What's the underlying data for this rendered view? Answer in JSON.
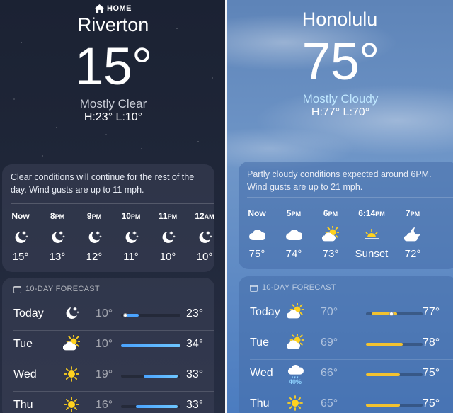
{
  "left": {
    "home_label": "HOME",
    "city": "Riverton",
    "temperature": "15°",
    "condition": "Mostly Clear",
    "high_low": "H:23°  L:10°",
    "summary": "Clear conditions will continue for the rest of the day. Wind gusts are up to 11 mph.",
    "hourly": [
      {
        "time": "Now",
        "suffix": "",
        "icon": "moon-stars-icon",
        "temp": "15°"
      },
      {
        "time": "8",
        "suffix": "PM",
        "icon": "moon-stars-icon",
        "temp": "13°"
      },
      {
        "time": "9",
        "suffix": "PM",
        "icon": "moon-stars-icon",
        "temp": "12°"
      },
      {
        "time": "10",
        "suffix": "PM",
        "icon": "moon-stars-icon",
        "temp": "11°"
      },
      {
        "time": "11",
        "suffix": "PM",
        "icon": "moon-stars-icon",
        "temp": "10°"
      },
      {
        "time": "12",
        "suffix": "AM",
        "icon": "moon-stars-icon",
        "temp": "10°"
      }
    ],
    "forecast_title": "10-DAY FORECAST",
    "daily": [
      {
        "day": "Today",
        "icon": "moon-stars-icon",
        "low": "10°",
        "high": "23°",
        "range": [
          0.05,
          0.3
        ],
        "current": 0.07
      },
      {
        "day": "Tue",
        "icon": "partly-cloudy-sun-icon",
        "low": "10°",
        "high": "34°",
        "range": [
          0.0,
          1.0
        ]
      },
      {
        "day": "Wed",
        "icon": "sun-icon",
        "low": "19°",
        "high": "33°",
        "range": [
          0.38,
          0.95
        ]
      },
      {
        "day": "Thu",
        "icon": "sun-icon",
        "low": "16°",
        "high": "33°",
        "range": [
          0.25,
          0.95
        ]
      }
    ]
  },
  "right": {
    "city": "Honolulu",
    "temperature": "75°",
    "condition": "Mostly Cloudy",
    "high_low": "H:77°  L:70°",
    "summary": "Partly cloudy conditions expected around 6PM. Wind gusts are up to 21 mph.",
    "hourly": [
      {
        "time": "Now",
        "suffix": "",
        "icon": "cloud-icon",
        "temp": "75°"
      },
      {
        "time": "5",
        "suffix": "PM",
        "icon": "cloud-icon",
        "temp": "74°"
      },
      {
        "time": "6",
        "suffix": "PM",
        "icon": "partly-cloudy-sun-icon",
        "temp": "73°"
      },
      {
        "time": "6:14",
        "suffix": "PM",
        "icon": "sunset-icon",
        "temp": "Sunset"
      },
      {
        "time": "7",
        "suffix": "PM",
        "icon": "partly-cloudy-moon-icon",
        "temp": "72°"
      }
    ],
    "forecast_title": "10-DAY FORECAST",
    "daily": [
      {
        "day": "Today",
        "icon": "partly-cloudy-sun-icon",
        "low": "70°",
        "high": "77°",
        "range": [
          0.1,
          0.55
        ],
        "current": 0.45
      },
      {
        "day": "Tue",
        "icon": "partly-cloudy-sun-icon",
        "low": "69°",
        "high": "78°",
        "range": [
          0.0,
          0.65
        ]
      },
      {
        "day": "Wed",
        "icon": "rain-cloud-icon",
        "low": "66°",
        "high": "75°",
        "precip": "40%",
        "range": [
          0.0,
          0.6
        ]
      },
      {
        "day": "Thu",
        "icon": "sun-icon",
        "low": "65°",
        "high": "75°",
        "range": [
          0.0,
          0.6
        ]
      }
    ]
  },
  "colors": {
    "temp_cool": "#4aa3ff",
    "temp_warm": "#f2c230",
    "sun": "#ffd21f"
  }
}
